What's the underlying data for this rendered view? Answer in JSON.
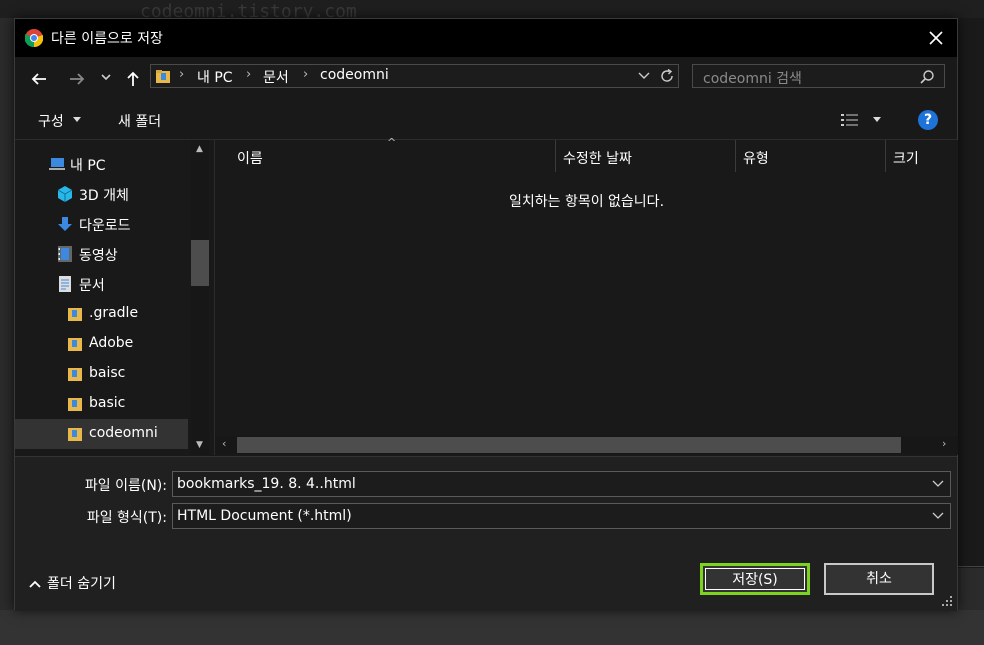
{
  "background": {
    "header_text": "codeomni.tistory.com"
  },
  "dialog": {
    "title": "다른 이름으로 저장",
    "address": {
      "crumbs": [
        "내 PC",
        "문서",
        "codeomni"
      ]
    },
    "search_placeholder": "codeomni 검색",
    "toolbar": {
      "organize": "구성",
      "new_folder": "새 폴더",
      "help": "?"
    },
    "sidebar": {
      "items": [
        {
          "label": "내 PC",
          "icon": "pc-icon"
        },
        {
          "label": "3D 개체",
          "icon": "cube-icon"
        },
        {
          "label": "다운로드",
          "icon": "download-icon"
        },
        {
          "label": "동영상",
          "icon": "video-icon"
        },
        {
          "label": "문서",
          "icon": "document-icon"
        },
        {
          "label": ".gradle",
          "icon": "folder-icon"
        },
        {
          "label": "Adobe",
          "icon": "folder-icon"
        },
        {
          "label": "baisc",
          "icon": "folder-icon"
        },
        {
          "label": "basic",
          "icon": "folder-icon"
        },
        {
          "label": "codeomni",
          "icon": "folder-icon",
          "selected": true
        }
      ]
    },
    "columns": [
      "이름",
      "수정한 날짜",
      "유형",
      "크기"
    ],
    "empty_message": "일치하는 항목이 없습니다.",
    "file_name_label": "파일 이름(N):",
    "file_name_value": "bookmarks_19. 8. 4..html",
    "file_type_label": "파일 형식(T):",
    "file_type_value": "HTML Document (*.html)",
    "hide_folders": "폴더 숨기기",
    "save_button": "저장(S)",
    "cancel_button": "취소",
    "colors": {
      "highlight": "#7ed321",
      "help": "#1e73d8",
      "folder": "#e8b84a"
    }
  }
}
